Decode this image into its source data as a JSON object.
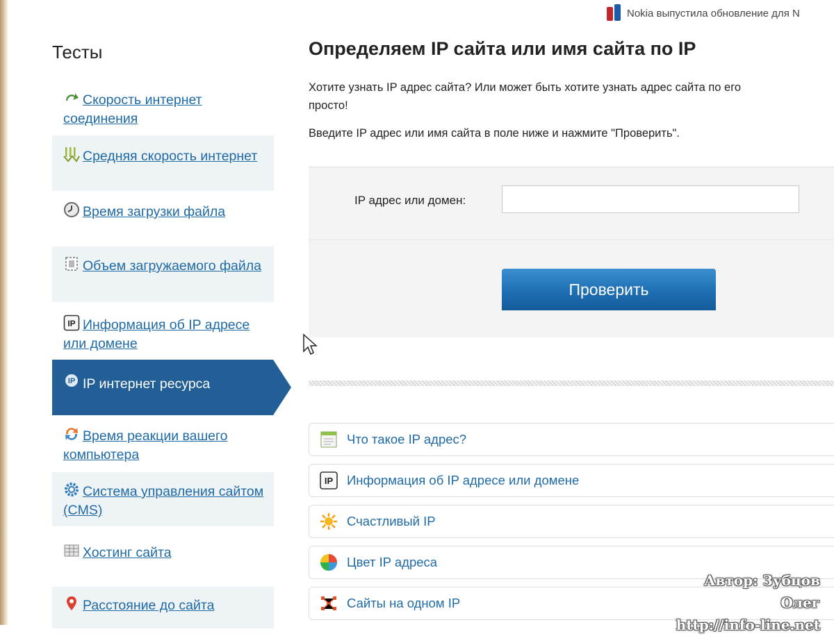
{
  "news": {
    "text": "Nokia выпустила обновление для N"
  },
  "sidebar": {
    "title": "Тесты",
    "items": [
      {
        "label": "Скорость интернет соединения",
        "icon": "green-arrow-icon"
      },
      {
        "label": "Средняя скорость интернет",
        "icon": "speed-bars-icon"
      },
      {
        "label": "Время загрузки файла",
        "icon": "clock-icon"
      },
      {
        "label": "Объем загружаемого файла",
        "icon": "file-size-icon"
      },
      {
        "label": "Информация об IP адресе или домене",
        "icon": "ip-icon"
      },
      {
        "label": "IP интернет ресурса",
        "icon": "ip-globe-icon"
      },
      {
        "label": "Время реакции вашего компьютера",
        "icon": "refresh-icon"
      },
      {
        "label": "Система управления сайтом (CMS)",
        "icon": "gear-icon"
      },
      {
        "label": "Хостинг сайта",
        "icon": "server-icon"
      },
      {
        "label": "Расстояние до сайта",
        "icon": "map-pin-icon"
      }
    ]
  },
  "main": {
    "title": "Определяем IP сайта или имя сайта по IP",
    "intro_line1": "Хотите узнать IP адрес сайта? Или может быть хотите узнать адрес сайта по его",
    "intro_line2": "просто!",
    "instruction": "Введите IP адрес или имя сайта в поле ниже и нажмите \"Проверить\".",
    "form": {
      "label": "IP адрес или домен:",
      "input_value": "",
      "button_label": "Проверить"
    },
    "related": [
      {
        "label": "Что такое IP адрес?",
        "icon": "document-icon"
      },
      {
        "label": "Информация об IP адресе или домене",
        "icon": "ip-icon"
      },
      {
        "label": "Счастливый IP",
        "icon": "sun-icon"
      },
      {
        "label": "Цвет IP адреса",
        "icon": "color-wheel-icon"
      },
      {
        "label": "Сайты на одном IP",
        "icon": "network-icon"
      }
    ]
  },
  "watermark": {
    "author": "Автор: Зубцов Олег",
    "url": "http://info-line.net"
  },
  "colors": {
    "link": "#1f6aa5",
    "active_bg": "#225f96",
    "button": "#1e6fb3",
    "shaded_bg": "#eef3f5"
  }
}
